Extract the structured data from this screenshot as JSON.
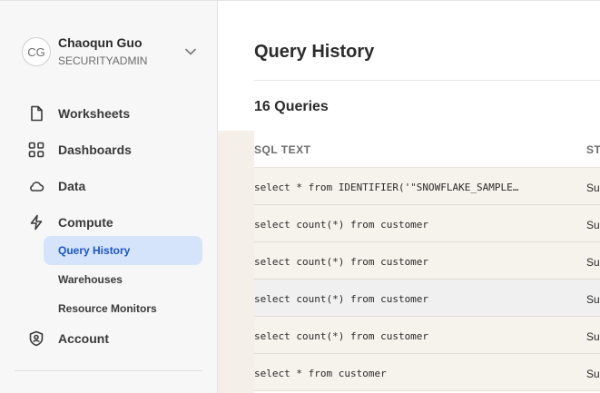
{
  "user": {
    "initials": "CG",
    "name": "Chaoqun Guo",
    "role": "SECURITYADMIN"
  },
  "nav": {
    "worksheets": {
      "label": "Worksheets",
      "icon": "document-icon"
    },
    "dashboards": {
      "label": "Dashboards",
      "icon": "grid-icon"
    },
    "data": {
      "label": "Data",
      "icon": "cloud-icon"
    },
    "compute": {
      "label": "Compute",
      "icon": "bolt-icon",
      "children": [
        {
          "label": "Query History",
          "active": true
        },
        {
          "label": "Warehouses",
          "active": false
        },
        {
          "label": "Resource Monitors",
          "active": false
        }
      ]
    },
    "account": {
      "label": "Account",
      "icon": "shield-user-icon"
    }
  },
  "main": {
    "title": "Query History",
    "count_label": "16 Queries",
    "columns": {
      "sql": "SQL TEXT",
      "status": "ST"
    },
    "rows": [
      {
        "sql": "select * from IDENTIFIER('\"SNOWFLAKE_SAMPLE…",
        "status": "Su"
      },
      {
        "sql": "select count(*) from customer",
        "status": "Su"
      },
      {
        "sql": "select count(*) from customer",
        "status": "Su"
      },
      {
        "sql": "select count(*) from customer",
        "status": "Su"
      },
      {
        "sql": "select count(*) from customer",
        "status": "Su"
      },
      {
        "sql": "select * from customer",
        "status": "Su"
      }
    ]
  },
  "colors": {
    "active_bg": "#d6e4fb",
    "active_text": "#1a56c4",
    "row_bg": "#f6f2ec"
  }
}
